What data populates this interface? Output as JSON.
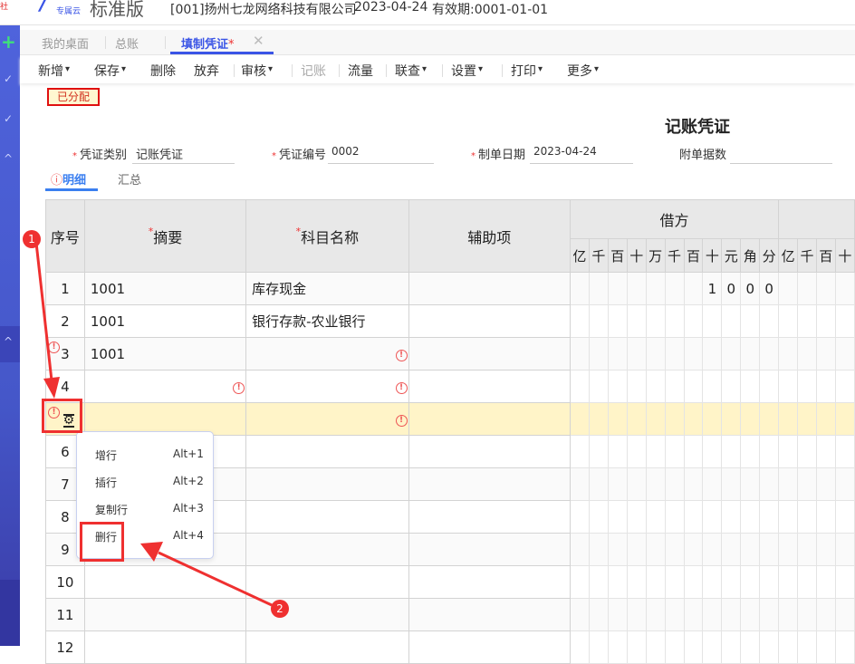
{
  "header": {
    "corner_text": "社",
    "logo_sub": "专属云",
    "logo_title": "标准版",
    "company": "[001]扬州七龙网络科技有限公司",
    "date": "2023-04-24",
    "validity": "有效期:0001-01-01"
  },
  "tabs": [
    {
      "label": "我的桌面"
    },
    {
      "label": "总账"
    },
    {
      "label": "填制凭证",
      "modified": "*"
    }
  ],
  "toolbar": [
    "新增",
    "保存",
    "删除",
    "放弃",
    "审核",
    "记账",
    "流量",
    "联查",
    "设置",
    "打印",
    "更多"
  ],
  "status_tag": "已分配",
  "voucher_title": "记账凭证",
  "fields": {
    "type_label": "凭证类别",
    "type_value": "记账凭证",
    "no_label": "凭证编号",
    "no_value": "0002",
    "date_label": "制单日期",
    "date_value": "2023-04-24",
    "attach_label": "附单据数",
    "attach_value": ""
  },
  "subtabs": {
    "detail": "明细",
    "summary": "汇总"
  },
  "table": {
    "headers": {
      "seq": "序号",
      "summary": "摘要",
      "account": "科目名称",
      "aux": "辅助项",
      "debit": "借方"
    },
    "digits": [
      "亿",
      "千",
      "百",
      "十",
      "万",
      "千",
      "百",
      "十",
      "元",
      "角",
      "分"
    ],
    "credit_digits": [
      "亿",
      "千",
      "百",
      "十"
    ],
    "rows": [
      {
        "seq": "1",
        "summary": "1001",
        "account": "库存现金",
        "debit": [
          "",
          "",
          "",
          "",
          "",
          "",
          "",
          "1",
          "0",
          "0",
          "0"
        ]
      },
      {
        "seq": "2",
        "summary": "1001",
        "account": "银行存款-农业银行"
      },
      {
        "seq": "3",
        "summary": "1001",
        "account": ""
      },
      {
        "seq": "4",
        "summary": "",
        "account": ""
      },
      {
        "seq": "",
        "summary": "",
        "account": ""
      },
      {
        "seq": "6"
      },
      {
        "seq": "7"
      },
      {
        "seq": "8"
      },
      {
        "seq": "9"
      },
      {
        "seq": "10"
      },
      {
        "seq": "11"
      },
      {
        "seq": "12"
      }
    ]
  },
  "context_menu": [
    {
      "label": "增行",
      "key": "Alt+1"
    },
    {
      "label": "插行",
      "key": "Alt+2"
    },
    {
      "label": "复制行",
      "key": "Alt+3"
    },
    {
      "label": "删行",
      "key": "Alt+4"
    }
  ],
  "annotations": [
    "1",
    "2"
  ]
}
